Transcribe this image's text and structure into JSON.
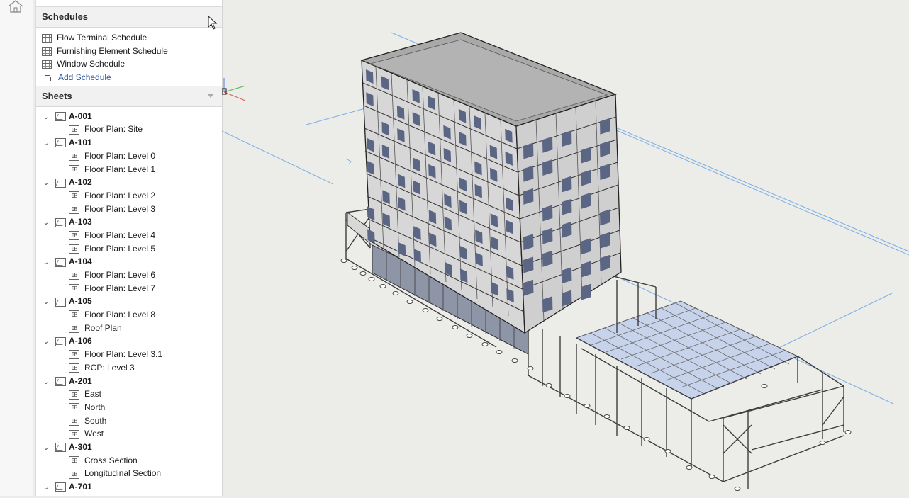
{
  "left_rail": {
    "home_icon": "home-icon"
  },
  "schedules": {
    "title": "Schedules",
    "items": [
      {
        "label": "Flow Terminal Schedule",
        "icon": "table-icon"
      },
      {
        "label": "Furnishing Element Schedule",
        "icon": "table-icon"
      },
      {
        "label": "Window Schedule",
        "icon": "table-icon"
      }
    ],
    "add_label": "Add Schedule"
  },
  "sheets": {
    "title": "Sheets",
    "groups": [
      {
        "name": "A-001",
        "views": [
          "Floor Plan: Site"
        ]
      },
      {
        "name": "A-101",
        "views": [
          "Floor Plan: Level 0",
          "Floor Plan: Level 1"
        ]
      },
      {
        "name": "A-102",
        "views": [
          "Floor Plan: Level 2",
          "Floor Plan: Level 3"
        ]
      },
      {
        "name": "A-103",
        "views": [
          "Floor Plan: Level 4",
          "Floor Plan: Level 5"
        ]
      },
      {
        "name": "A-104",
        "views": [
          "Floor Plan: Level 6",
          "Floor Plan: Level 7"
        ]
      },
      {
        "name": "A-105",
        "views": [
          "Floor Plan: Level 8",
          "Roof Plan"
        ]
      },
      {
        "name": "A-106",
        "views": [
          "Floor Plan: Level 3.1",
          "RCP: Level 3"
        ]
      },
      {
        "name": "A-201",
        "views": [
          "East",
          "North",
          "South",
          "West"
        ]
      },
      {
        "name": "A-301",
        "views": [
          "Cross Section",
          "Longitudinal Section"
        ]
      },
      {
        "name": "A-701",
        "views": []
      }
    ],
    "view_icon_text": "0B"
  },
  "viewport": {
    "name": "3D building model view"
  },
  "colors": {
    "link": "#2e55a4",
    "glass": "#c2cfe8",
    "gridline": "#7aaee6"
  }
}
